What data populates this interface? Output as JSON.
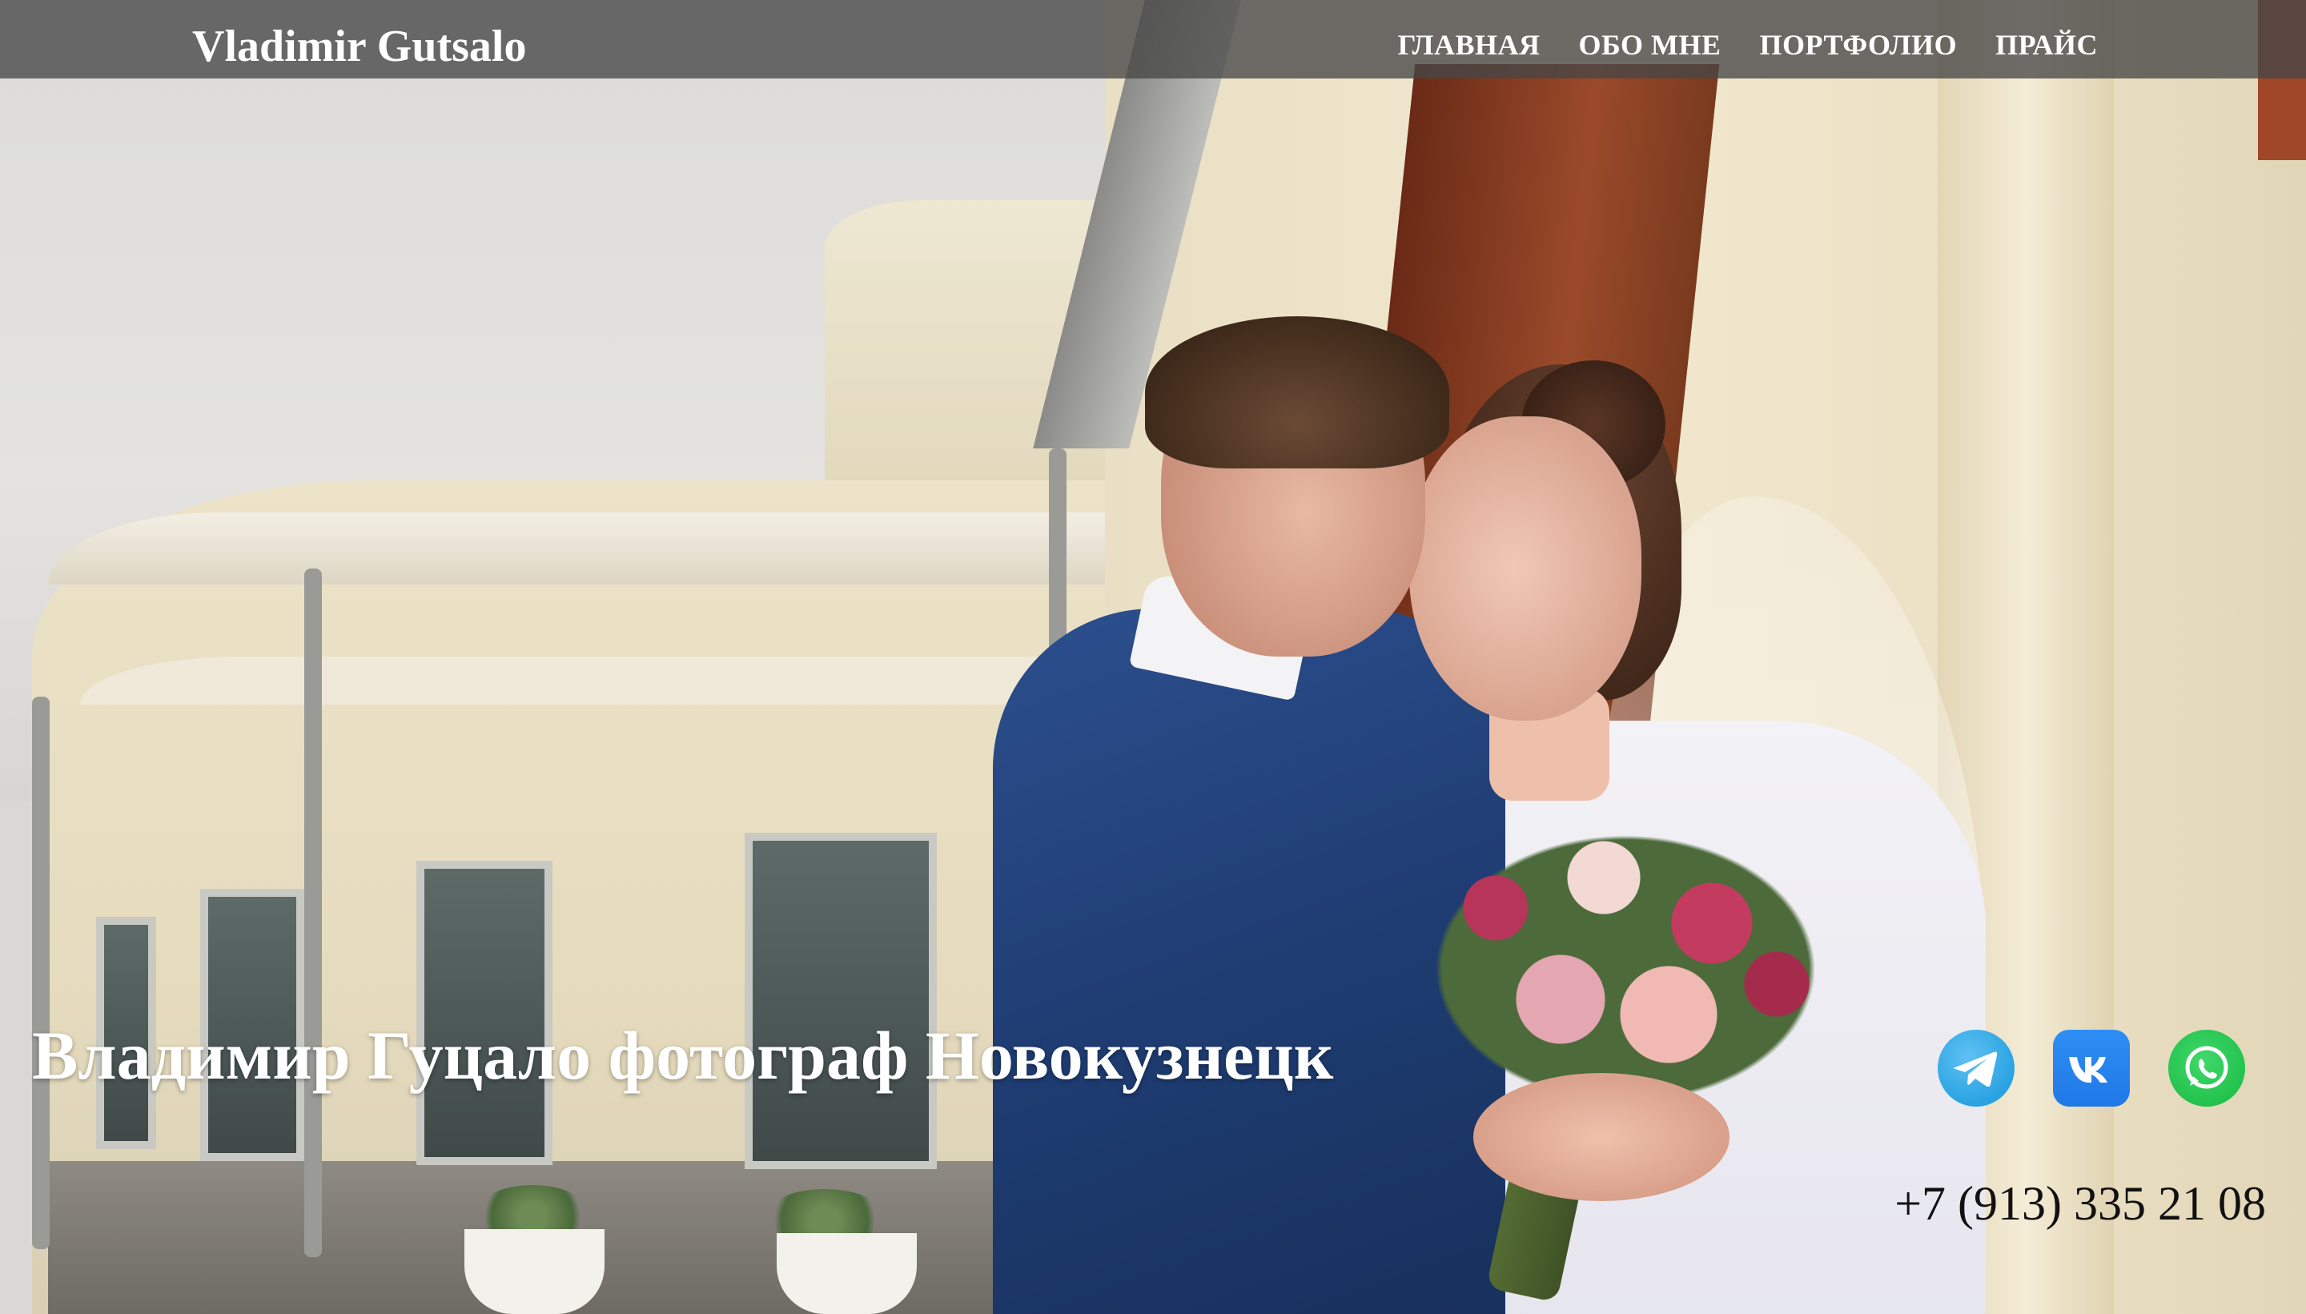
{
  "header": {
    "brand": "Vladimir Gutsalo",
    "nav": [
      {
        "label": "ГЛАВНАЯ"
      },
      {
        "label": "ОБО МНЕ"
      },
      {
        "label": "ПОРТФОЛИО"
      },
      {
        "label": "ПРАЙС"
      }
    ]
  },
  "hero": {
    "headline": "Владимир Гуцало фотограф Новокузнецк"
  },
  "contacts": {
    "socials": [
      {
        "name": "telegram",
        "icon": "telegram-icon",
        "color": "#2aa3e3"
      },
      {
        "name": "vk",
        "icon": "vk-icon",
        "color": "#1f78e6"
      },
      {
        "name": "whatsapp",
        "icon": "whatsapp-icon",
        "color": "#23c24e"
      }
    ],
    "phone": "+7 (913) 335 21 08"
  },
  "colors": {
    "navbar_bg": "#464646",
    "text_light": "#ffffff",
    "text_dark": "#111111"
  }
}
